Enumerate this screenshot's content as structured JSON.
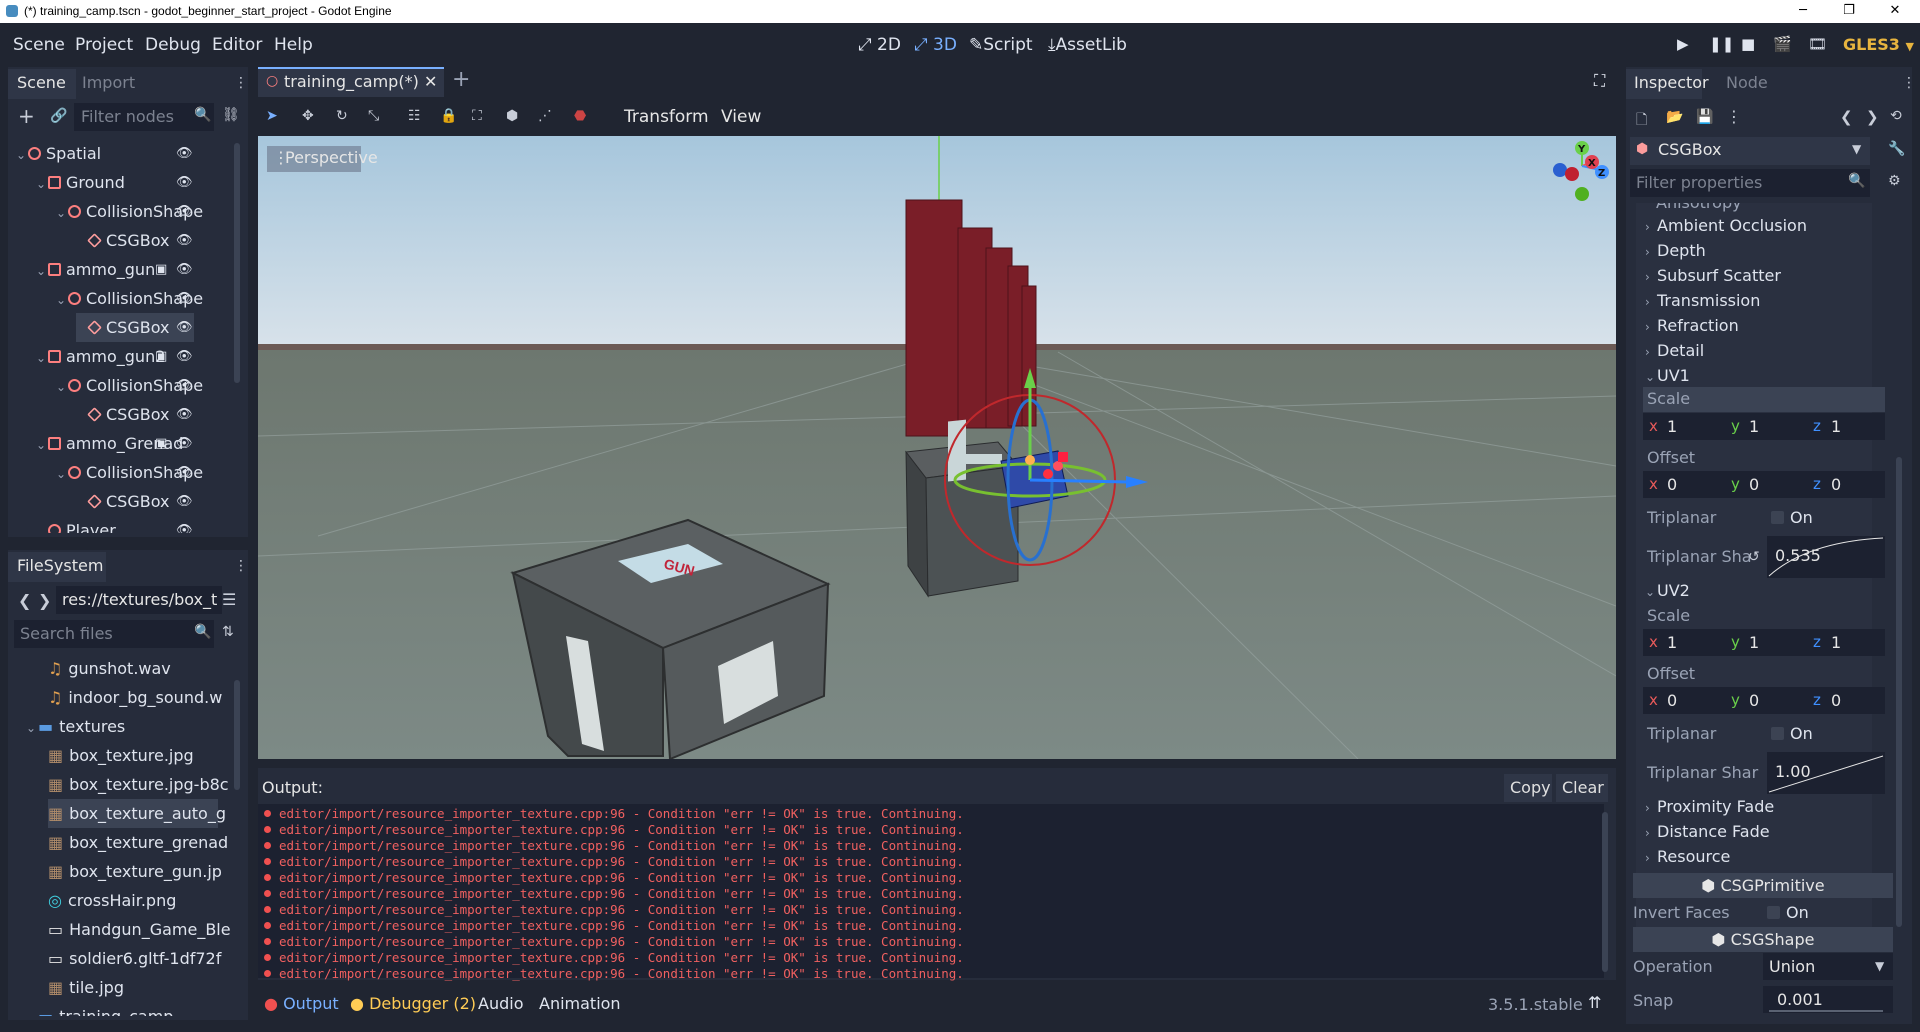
{
  "window": {
    "title": "(*) training_camp.tscn - godot_beginner_start_project - Godot Engine",
    "controls": [
      "─",
      "❐",
      "✕"
    ]
  },
  "menu": {
    "items": [
      "Scene",
      "Project",
      "Debug",
      "Editor",
      "Help"
    ],
    "workspaces": [
      {
        "label": "2D",
        "icon": "2d-icon"
      },
      {
        "label": "3D",
        "icon": "3d-icon",
        "active": true
      },
      {
        "label": "Script",
        "icon": "script-icon"
      },
      {
        "label": "AssetLib",
        "icon": "assetlib-icon"
      }
    ],
    "renderer": "GLES3"
  },
  "scene_dock": {
    "tabs": [
      "Scene",
      "Import"
    ],
    "filter_placeholder": "Filter nodes",
    "tree": [
      {
        "label": "Spatial",
        "depth": 0,
        "icon": "spatial"
      },
      {
        "label": "Ground",
        "depth": 1,
        "icon": "body"
      },
      {
        "label": "CollisionShape",
        "depth": 2,
        "icon": "collision"
      },
      {
        "label": "CSGBox",
        "depth": 3,
        "icon": "csg"
      },
      {
        "label": "ammo_gun",
        "depth": 1,
        "icon": "body",
        "extra": true
      },
      {
        "label": "CollisionShape",
        "depth": 2,
        "icon": "collision"
      },
      {
        "label": "CSGBox",
        "depth": 3,
        "icon": "csg",
        "selected": true
      },
      {
        "label": "ammo_gun2",
        "depth": 1,
        "icon": "body",
        "extra": true
      },
      {
        "label": "CollisionShape",
        "depth": 2,
        "icon": "collision"
      },
      {
        "label": "CSGBox",
        "depth": 3,
        "icon": "csg"
      },
      {
        "label": "ammo_Grenad",
        "depth": 1,
        "icon": "body",
        "extra": true
      },
      {
        "label": "CollisionShape",
        "depth": 2,
        "icon": "collision"
      },
      {
        "label": "CSGBox",
        "depth": 3,
        "icon": "csg"
      },
      {
        "label": "Player",
        "depth": 1,
        "icon": "player"
      }
    ]
  },
  "filesystem": {
    "tab": "FileSystem",
    "path": "res://textures/box_t",
    "search_placeholder": "Search files",
    "files": [
      {
        "label": "gunshot.wav",
        "type": "audio",
        "depth": 2
      },
      {
        "label": "indoor_bg_sound.w",
        "type": "audio",
        "depth": 2
      },
      {
        "label": "textures",
        "type": "folder",
        "depth": 1
      },
      {
        "label": "box_texture.jpg",
        "type": "image",
        "depth": 2
      },
      {
        "label": "box_texture.jpg-b8c",
        "type": "image",
        "depth": 2
      },
      {
        "label": "box_texture_auto_g",
        "type": "image",
        "depth": 2,
        "selected": true
      },
      {
        "label": "box_texture_grenad",
        "type": "image",
        "depth": 2
      },
      {
        "label": "box_texture_gun.jp",
        "type": "image",
        "depth": 2
      },
      {
        "label": "crossHair.png",
        "type": "crosshair",
        "depth": 2
      },
      {
        "label": "Handgun_Game_Ble",
        "type": "file",
        "depth": 2
      },
      {
        "label": "soldier6.gltf-1df72f",
        "type": "file",
        "depth": 2
      },
      {
        "label": "tile.jpg",
        "type": "image",
        "depth": 2
      },
      {
        "label": "training_camp",
        "type": "folder",
        "depth": 1
      }
    ]
  },
  "editor": {
    "tab_label": "training_camp(*)",
    "toolbar_menus": [
      "Transform",
      "View"
    ],
    "viewport_label": "Perspective",
    "gizmo_axes": [
      "Y",
      "X",
      "Z"
    ]
  },
  "output": {
    "title": "Output:",
    "copy_label": "Copy",
    "clear_label": "Clear",
    "lines": [
      "editor/import/resource_importer_texture.cpp:96 - Condition \"err != OK\" is true. Continuing.",
      "editor/import/resource_importer_texture.cpp:96 - Condition \"err != OK\" is true. Continuing.",
      "editor/import/resource_importer_texture.cpp:96 - Condition \"err != OK\" is true. Continuing.",
      "editor/import/resource_importer_texture.cpp:96 - Condition \"err != OK\" is true. Continuing.",
      "editor/import/resource_importer_texture.cpp:96 - Condition \"err != OK\" is true. Continuing.",
      "editor/import/resource_importer_texture.cpp:96 - Condition \"err != OK\" is true. Continuing.",
      "editor/import/resource_importer_texture.cpp:96 - Condition \"err != OK\" is true. Continuing.",
      "editor/import/resource_importer_texture.cpp:96 - Condition \"err != OK\" is true. Continuing.",
      "editor/import/resource_importer_texture.cpp:96 - Condition \"err != OK\" is true. Continuing.",
      "editor/import/resource_importer_texture.cpp:96 - Condition \"err != OK\" is true. Continuing.",
      "editor/import/resource_importer_texture.cpp:96 - Condition \"err != OK\" is true. Continuing."
    ],
    "bottom_tabs": [
      "Output",
      "Debugger (2)",
      "Audio",
      "Animation"
    ],
    "version": "3.5.1.stable"
  },
  "inspector": {
    "tabs": [
      "Inspector",
      "Node"
    ],
    "object_name": "CSGBox",
    "filter_placeholder": "Filter properties",
    "truncated_top": "Anisotropy",
    "categories_top": [
      "Ambient Occlusion",
      "Depth",
      "Subsurf Scatter",
      "Transmission",
      "Refraction",
      "Detail"
    ],
    "uv1": {
      "label": "UV1",
      "scale_label": "Scale",
      "scale": {
        "x": "1",
        "y": "1",
        "z": "1"
      },
      "offset_label": "Offset",
      "offset": {
        "x": "0",
        "y": "0",
        "z": "0"
      },
      "triplanar_label": "Triplanar",
      "triplanar_value": "On",
      "sharpness_label": "Triplanar Sha",
      "sharpness_value": "0.535"
    },
    "uv2": {
      "label": "UV2",
      "scale_label": "Scale",
      "scale": {
        "x": "1",
        "y": "1",
        "z": "1"
      },
      "offset_label": "Offset",
      "offset": {
        "x": "0",
        "y": "0",
        "z": "0"
      },
      "triplanar_label": "Triplanar",
      "triplanar_value": "On",
      "sharpness_label": "Triplanar Shar",
      "sharpness_value": "1.00"
    },
    "categories_bottom": [
      "Proximity Fade",
      "Distance Fade",
      "Resource"
    ],
    "csg_primitive": {
      "header": "CSGPrimitive",
      "invert_faces_label": "Invert Faces",
      "invert_faces_value": "On"
    },
    "csg_shape": {
      "header": "CSGShape",
      "operation_label": "Operation",
      "operation_value": "Union",
      "snap_label": "Snap",
      "snap_value": "0.001"
    }
  },
  "colors": {
    "accent": "#79b0ff",
    "background": "#202531",
    "panel": "#262c3b",
    "error": "#f06060",
    "warning": "#ffcc55",
    "renderer": "#e8b53f"
  }
}
